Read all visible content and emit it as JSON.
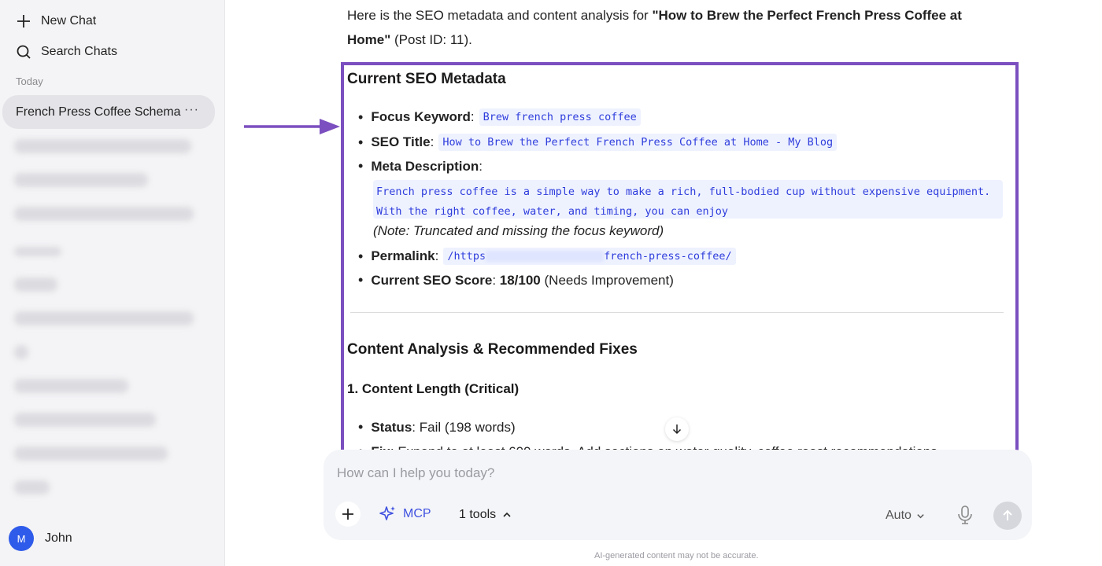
{
  "sidebar": {
    "new_chat": "New Chat",
    "search_chats": "Search Chats",
    "section_today": "Today",
    "active_chat": "French Press Coffee Schema",
    "more_label": "···",
    "user": {
      "initial": "M",
      "name": "John"
    }
  },
  "message": {
    "intro_prefix": "Here is the SEO metadata and content analysis for ",
    "intro_title": "\"How to Brew the Perfect French Press Coffee at Home\"",
    "intro_suffix": " (Post ID: 11).",
    "seo_heading": "Current SEO Metadata",
    "focus_label": "Focus Keyword",
    "focus_value": "Brew french press coffee",
    "title_label": "SEO Title",
    "title_value": "How to Brew the Perfect French Press Coffee at Home - My Blog",
    "meta_label": "Meta Description",
    "meta_line1": "French press coffee is a simple way to make a rich, full-bodied cup without expensive equipment.",
    "meta_line2": "With the right coffee, water, and timing, you can enjoy",
    "meta_note": "(Note: Truncated and missing the focus keyword)",
    "permalink_label": "Permalink",
    "permalink_prefix": "/https",
    "permalink_suffix": "french-press-coffee/",
    "score_label": "Current SEO Score",
    "score_value": "18/100",
    "score_note": "(Needs Improvement)",
    "analysis_heading": "Content Analysis & Recommended Fixes",
    "length_heading": "1. Content Length (Critical)",
    "status_label": "Status",
    "status_value": "Fail (198 words)",
    "fix_label": "Fix",
    "fix_value": "Expand to at least 600 words. Add sections on water quality, coffee roast recommendations"
  },
  "composer": {
    "placeholder": "How can I help you today?",
    "mcp_label": "MCP",
    "tools_label": "1 tools",
    "model_label": "Auto"
  },
  "disclaimer": "AI-generated content may not be accurate.",
  "colors": {
    "accent": "#7b4fbf",
    "code": "#2f3ddc",
    "mcp": "#3f51e0",
    "avatar": "#2f5bea"
  }
}
